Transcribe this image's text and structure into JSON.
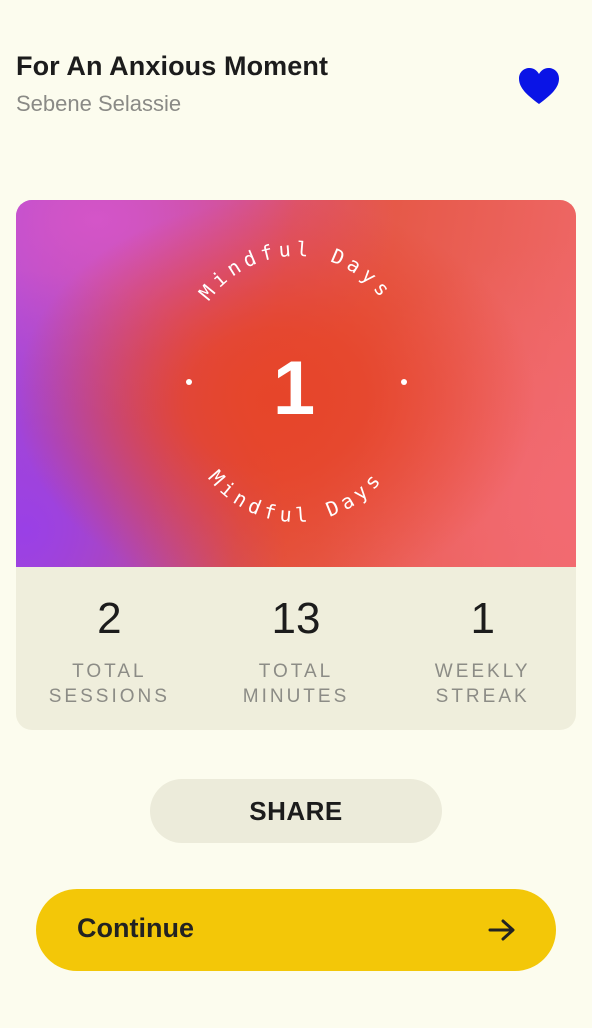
{
  "session": {
    "title": "For An Anxious Moment",
    "author": "Sebene Selassie"
  },
  "badge": {
    "count": "1",
    "ring_text": "Mindful Days",
    "gradient_colors": [
      "#a24ae0",
      "#e6452a",
      "#f06a6c"
    ]
  },
  "stats": [
    {
      "value": "2",
      "label_line1": "TOTAL",
      "label_line2": "SESSIONS"
    },
    {
      "value": "13",
      "label_line1": "TOTAL",
      "label_line2": "MINUTES"
    },
    {
      "value": "1",
      "label_line1": "WEEKLY",
      "label_line2": "STREAK"
    }
  ],
  "actions": {
    "share_label": "SHARE",
    "continue_label": "Continue"
  },
  "icons": {
    "favorite": "heart-icon",
    "continue": "arrow-right-icon"
  },
  "colors": {
    "background": "#fcfcee",
    "heart": "#0a14e6",
    "continue_button": "#f3c708",
    "share_button": "#ecebda",
    "stats_panel": "#efeedc"
  }
}
